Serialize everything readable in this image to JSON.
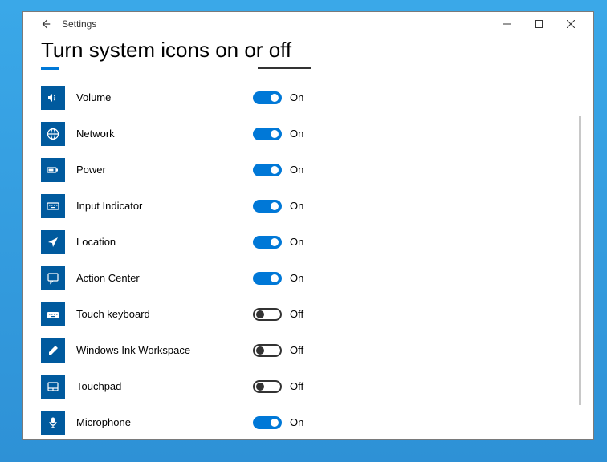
{
  "window": {
    "title": "Settings"
  },
  "page": {
    "heading": "Turn system icons on or off"
  },
  "labels": {
    "on": "On",
    "off": "Off"
  },
  "items": [
    {
      "id": "volume",
      "label": "Volume",
      "icon": "volume-icon",
      "state": true
    },
    {
      "id": "network",
      "label": "Network",
      "icon": "globe-icon",
      "state": true
    },
    {
      "id": "power",
      "label": "Power",
      "icon": "battery-icon",
      "state": true
    },
    {
      "id": "input-indicator",
      "label": "Input Indicator",
      "icon": "keyboard-icon",
      "state": true
    },
    {
      "id": "location",
      "label": "Location",
      "icon": "location-icon",
      "state": true
    },
    {
      "id": "action-center",
      "label": "Action Center",
      "icon": "action-center-icon",
      "state": true
    },
    {
      "id": "touch-keyboard",
      "label": "Touch keyboard",
      "icon": "touch-keyboard-icon",
      "state": false
    },
    {
      "id": "windows-ink",
      "label": "Windows Ink Workspace",
      "icon": "ink-icon",
      "state": false
    },
    {
      "id": "touchpad",
      "label": "Touchpad",
      "icon": "touchpad-icon",
      "state": false
    },
    {
      "id": "microphone",
      "label": "Microphone",
      "icon": "microphone-icon",
      "state": true
    }
  ]
}
